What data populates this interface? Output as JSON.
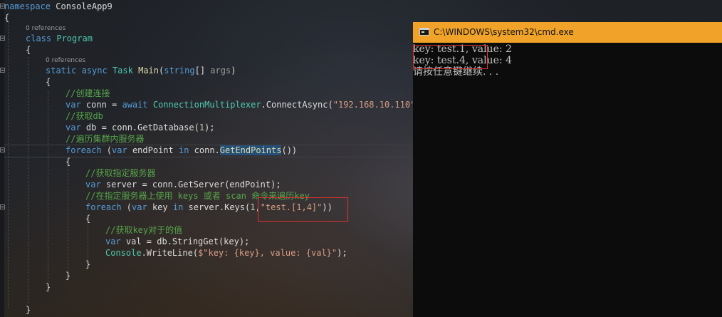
{
  "editor": {
    "code_lens_1": "0 references",
    "code_lens_2": "0 references",
    "namespace_kw": "namespace",
    "namespace_name": "ConsoleApp9",
    "open_brace_ns": "{",
    "class_kw": "class",
    "class_name": "Program",
    "open_brace_class": "{",
    "static_kw": "static",
    "async_kw": "async",
    "task_type": "Task",
    "main_name": "Main",
    "main_params_open": "(",
    "string_kw": "string",
    "array_brackets": "[] ",
    "args_param": "args",
    "main_params_close": ")",
    "open_brace_main": "{",
    "comment_connect": "//创建连接",
    "var_kw": "var",
    "conn_assign": " conn = ",
    "await_kw": "await",
    "conn_multiplexer_type": "ConnectionMultiplexer",
    "connect_async": ".ConnectAsync(",
    "conn_string": "\"192.168.10.110\"",
    "connect_close": ");",
    "comment_getdb": "//获取db",
    "db_assign": " db = conn.GetDatabase(",
    "db_index": "1",
    "db_close": ");",
    "comment_iterate": "//遍历集群内服务器",
    "foreach_kw": "foreach",
    "foreach_paren_open": " (",
    "endpoint_var": " endPoint ",
    "in_kw": "in",
    "conn_dot": " conn.",
    "get_end_points": "GetEndPoints",
    "foreach_paren_close": "())",
    "open_brace_foreach1": "{",
    "comment_getserver": "//获取指定服务器",
    "server_assign": " server = conn.GetServer(endPoint);",
    "comment_keys": "//在指定服务器上使用 keys 或者 scan 命令来遍历key",
    "key_var": " key ",
    "server_keys": " server.Keys(",
    "keys_db": "1",
    "keys_comma": ",",
    "keys_pattern": "\"test.[1,4]\"",
    "keys_close": "))",
    "open_brace_foreach2": "{",
    "comment_getvalue": "//获取key对于的值",
    "val_assign": " val = db.StringGet(key);",
    "console_type": "Console",
    "write_line": ".WriteLine(",
    "interp_string": "$\"key: {key}, value: {val}\"",
    "write_close": ");",
    "close_brace_foreach2": "}",
    "close_brace_foreach1": "}",
    "close_brace_main": "}",
    "close_brace_class": "}"
  },
  "cmd": {
    "title": "C:\\WINDOWS\\system32\\cmd.exe",
    "output_lines": [
      "key: test.1, value: 2",
      "key: test.4, value: 4",
      "请按任意键继续. . ."
    ],
    "title_bar_color": "#f0a328"
  },
  "colors": {
    "keyword": "#569cd6",
    "type": "#4ec9b0",
    "method": "#dcdcaa",
    "string": "#d69d85",
    "comment": "#57a64a",
    "annotation_box": "#e0312f"
  }
}
